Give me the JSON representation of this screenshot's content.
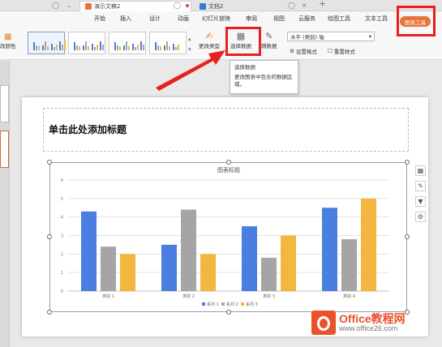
{
  "tabs": {
    "doc1": "演示文稿2",
    "doc2": "文档2",
    "add": "+"
  },
  "menu": [
    "开始",
    "插入",
    "设计",
    "动画",
    "幻灯片放映",
    "审阅",
    "视图",
    "云服务",
    "绘图工具",
    "文本工具"
  ],
  "chart_tools_label": "图表工具",
  "ribbon": {
    "change_color": "改颜色",
    "change_type": "更改类型",
    "select_data": "选择数据",
    "edit_data": "辑数据",
    "axis_dropdown": "水平 (类别) 轴",
    "set_format": "设置格式",
    "reset_style": "重置样式"
  },
  "tooltip": {
    "title": "选择数据",
    "description": "更改图表中包含的数据区域。"
  },
  "slide": {
    "title_placeholder": "单击此处添加标题"
  },
  "chart_data": {
    "type": "bar",
    "title": "图表标题",
    "categories": [
      "类别 1",
      "类别 2",
      "类别 3",
      "类别 4"
    ],
    "series": [
      {
        "name": "系列 1",
        "values": [
          4.3,
          2.5,
          3.5,
          4.5
        ]
      },
      {
        "name": "系列 2",
        "values": [
          2.4,
          4.4,
          1.8,
          2.8
        ]
      },
      {
        "name": "系列 3",
        "values": [
          2.0,
          2.0,
          3.0,
          5.0
        ]
      }
    ],
    "colors": [
      "#4a7ee0",
      "#a5a5a5",
      "#f3b63e"
    ],
    "ylim": [
      0,
      6
    ],
    "yticks": [
      "0",
      "1",
      "2",
      "3",
      "4",
      "5",
      "6"
    ],
    "grid": true,
    "legend": "bottom"
  },
  "watermark": {
    "line1": "Office教程网",
    "line2": "www.office26.com"
  },
  "colors": {
    "accent": "#e8743b",
    "highlight": "#e82020"
  }
}
